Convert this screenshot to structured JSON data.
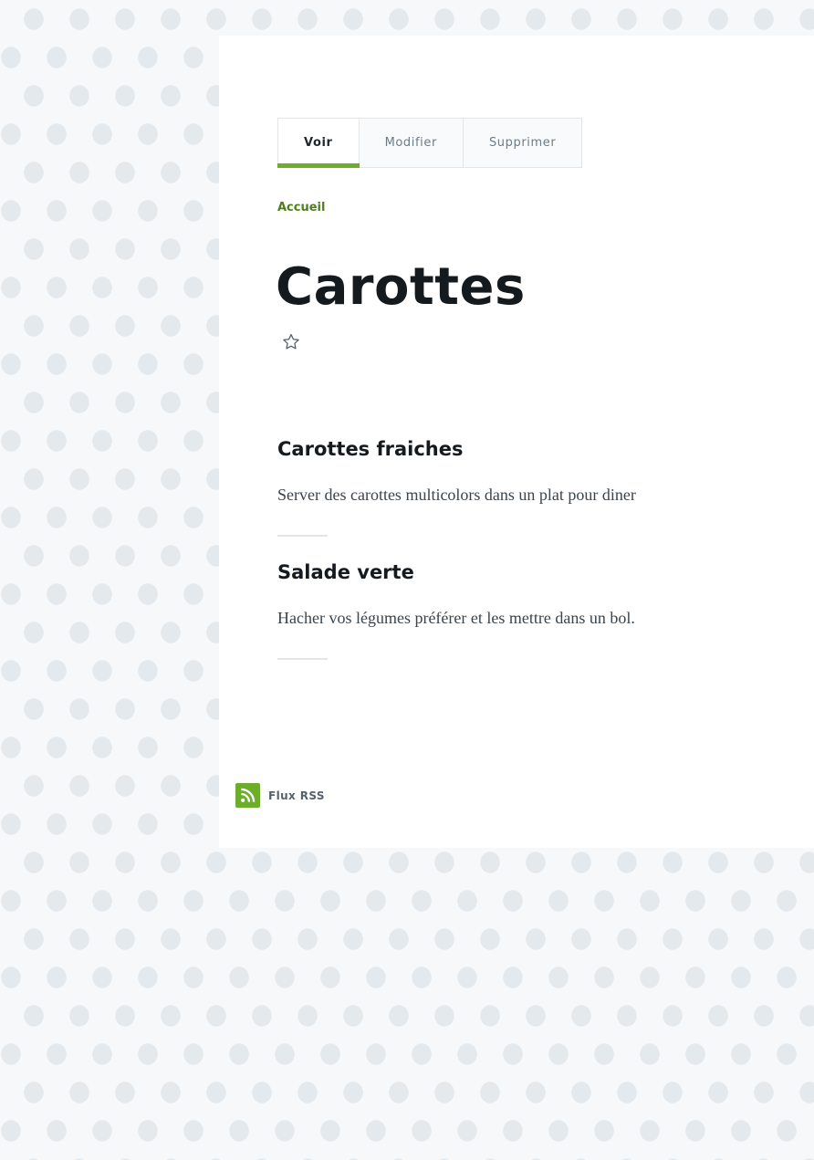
{
  "tabs": [
    {
      "label": "Voir",
      "active": true
    },
    {
      "label": "Modifier",
      "active": false
    },
    {
      "label": "Supprimer",
      "active": false
    }
  ],
  "breadcrumb": {
    "home": "Accueil"
  },
  "page": {
    "title": "Carottes"
  },
  "favorite": {
    "icon": "star-outline-icon"
  },
  "sections": [
    {
      "heading": "Carottes fraiches",
      "body": "Server des carottes multicolors dans un plat pour diner"
    },
    {
      "heading": "Salade verte",
      "body": "Hacher vos légumes préférer et les mettre dans un bol."
    }
  ],
  "footer": {
    "rss_label": "Flux RSS",
    "rss_icon": "rss-icon"
  },
  "colors": {
    "accent": "#6cae2a",
    "link": "#4e7f1f",
    "background_pattern": "#e4e9ed"
  }
}
